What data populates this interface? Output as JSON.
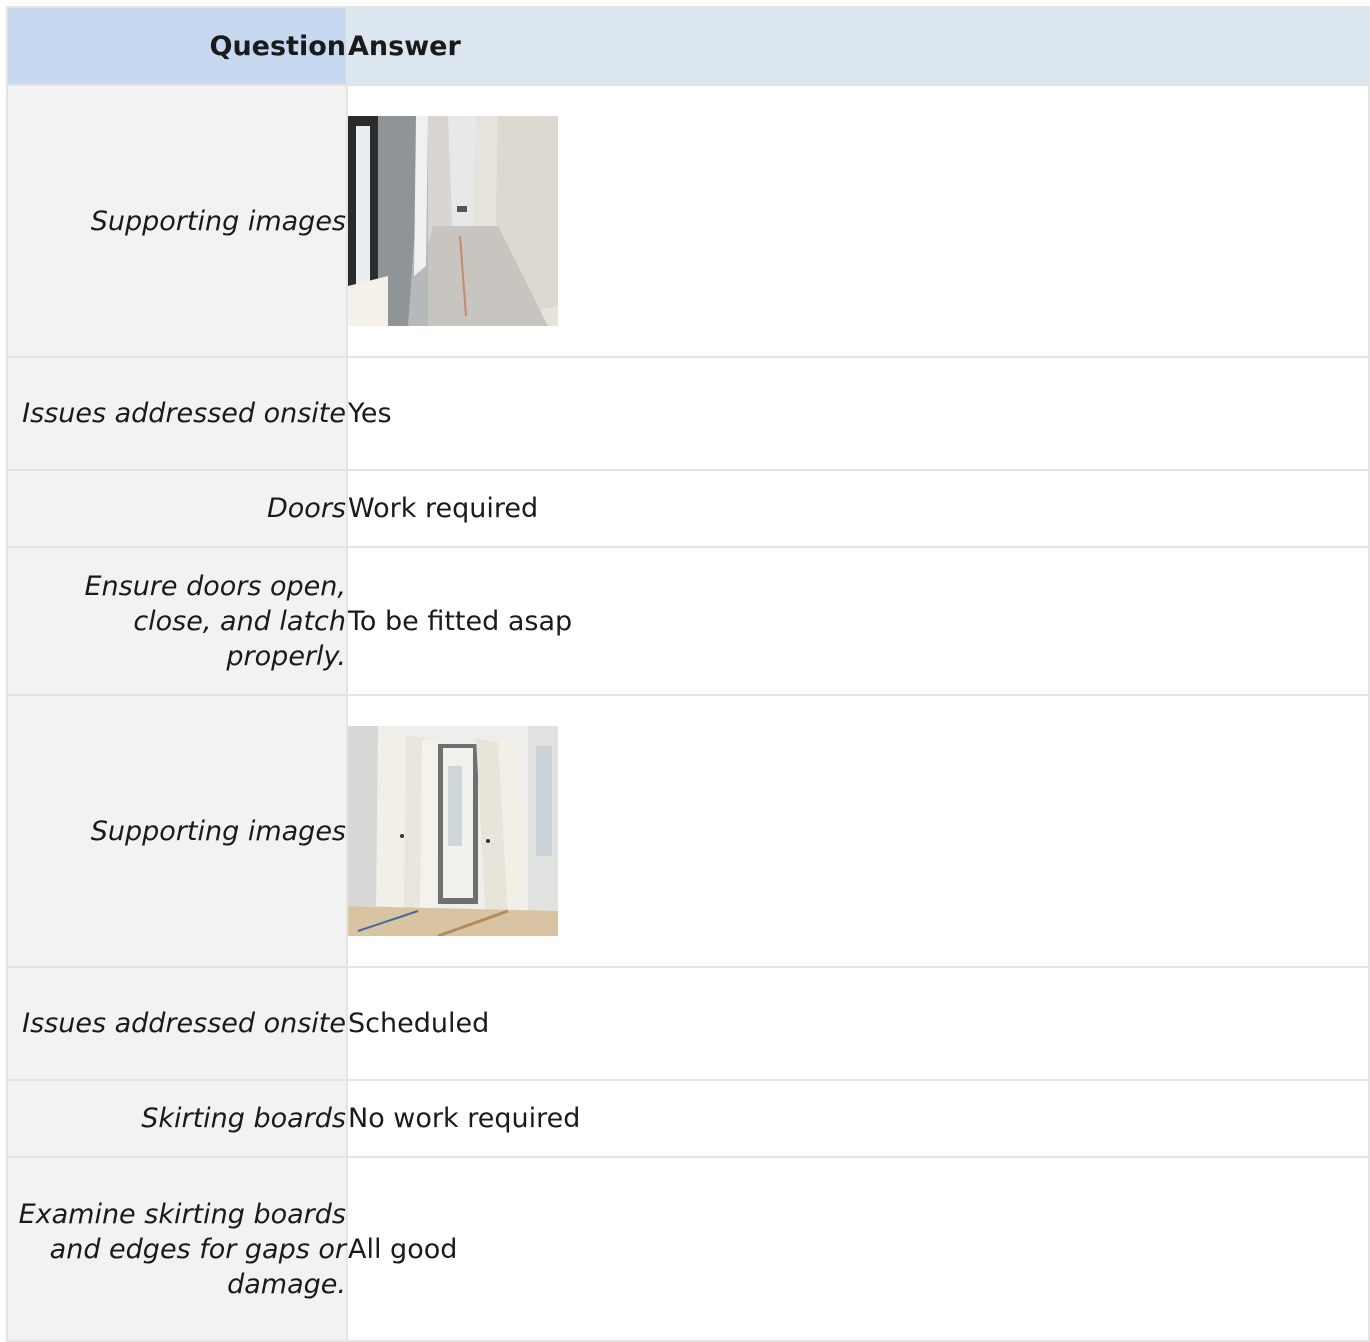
{
  "table": {
    "header": {
      "question": "Question",
      "answer": "Answer"
    },
    "rows": [
      {
        "question": "Supporting images",
        "answer_type": "image",
        "image": "hallway-window-photo"
      },
      {
        "question": "Issues addressed onsite",
        "answer": "Yes"
      },
      {
        "question": "Doors",
        "answer": "Work required"
      },
      {
        "question": "Ensure doors open, close, and latch properly.",
        "answer": "To be fitted asap"
      },
      {
        "question": "Supporting images",
        "answer_type": "image",
        "image": "doors-leaning-photo"
      },
      {
        "question": "Issues addressed onsite",
        "answer": "Scheduled"
      },
      {
        "question": "Skirting boards",
        "answer": "No work required"
      },
      {
        "question": "Examine skirting boards and edges for gaps or damage.",
        "answer": "All good"
      }
    ]
  }
}
